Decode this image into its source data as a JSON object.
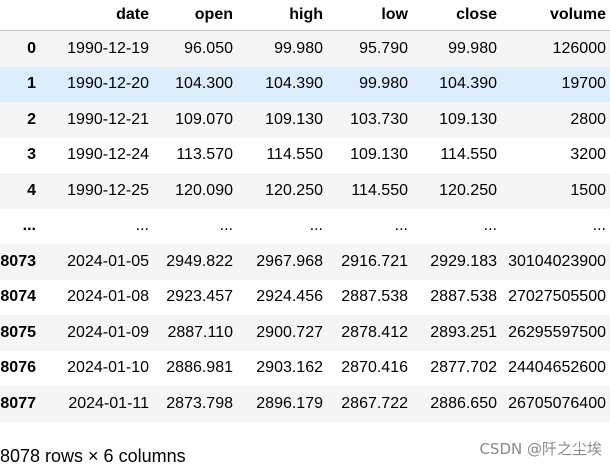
{
  "table": {
    "columns": [
      "",
      "date",
      "open",
      "high",
      "low",
      "close",
      "volume"
    ],
    "rows": [
      [
        "0",
        "1990-12-19",
        "96.050",
        "99.980",
        "95.790",
        "99.980",
        "126000"
      ],
      [
        "1",
        "1990-12-20",
        "104.300",
        "104.390",
        "99.980",
        "104.390",
        "19700"
      ],
      [
        "2",
        "1990-12-21",
        "109.070",
        "109.130",
        "103.730",
        "109.130",
        "2800"
      ],
      [
        "3",
        "1990-12-24",
        "113.570",
        "114.550",
        "109.130",
        "114.550",
        "3200"
      ],
      [
        "4",
        "1990-12-25",
        "120.090",
        "120.250",
        "114.550",
        "120.250",
        "1500"
      ],
      [
        "...",
        "...",
        "...",
        "...",
        "...",
        "...",
        "..."
      ],
      [
        "8073",
        "2024-01-05",
        "2949.822",
        "2967.968",
        "2916.721",
        "2929.183",
        "30104023900"
      ],
      [
        "8074",
        "2024-01-08",
        "2923.457",
        "2924.456",
        "2887.538",
        "2887.538",
        "27027505500"
      ],
      [
        "8075",
        "2024-01-09",
        "2887.110",
        "2900.727",
        "2878.412",
        "2893.251",
        "26295597500"
      ],
      [
        "8076",
        "2024-01-10",
        "2886.981",
        "2903.162",
        "2870.416",
        "2877.702",
        "24404652600"
      ],
      [
        "8077",
        "2024-01-11",
        "2873.798",
        "2896.179",
        "2867.722",
        "2886.650",
        "26705076400"
      ]
    ],
    "hovered_row_index": 1
  },
  "footer": {
    "shape_text": "8078 rows × 6 columns"
  },
  "watermark": {
    "text": "CSDN @阡之尘埃"
  },
  "colors": {
    "row_stripe": "#f5f5f5",
    "row_hover": "#dcedfb",
    "header_border": "#c7c7c7",
    "watermark": "#8a8a8a"
  }
}
